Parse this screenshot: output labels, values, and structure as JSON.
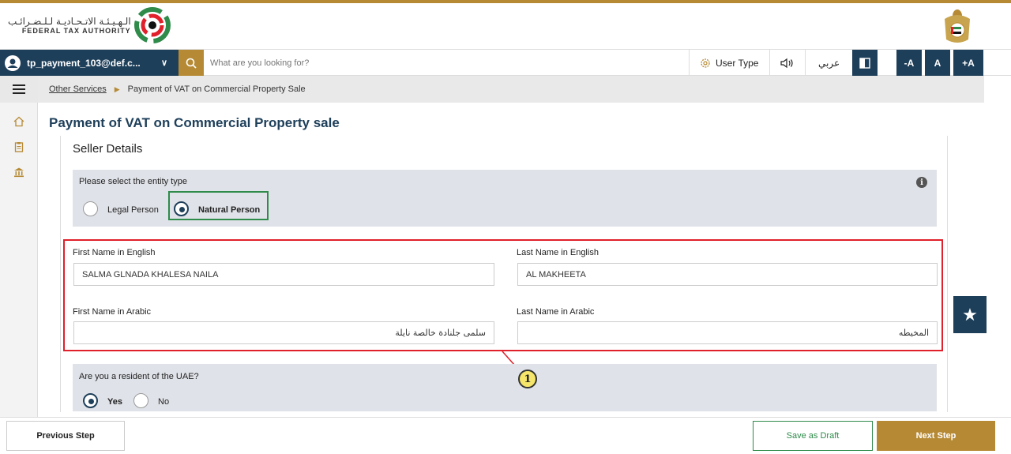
{
  "header": {
    "logo_ar": "الـهـيـئـة الاتـحـاديـة لـلـضـرائـب",
    "logo_en": "FEDERAL TAX AUTHORITY"
  },
  "navbar": {
    "user_email": "tp_payment_103@def.c...",
    "search_placeholder": "What are you looking for?",
    "user_type_label": "User Type",
    "language_label": "عربي",
    "font_decrease_label": "-A",
    "font_reset_label": "A",
    "font_increase_label": "+A"
  },
  "breadcrumb": {
    "parent": "Other Services",
    "current": "Payment of VAT on Commercial Property Sale"
  },
  "page": {
    "title": "Payment of VAT on Commercial Property sale",
    "section_title": "Seller Details"
  },
  "entity": {
    "question": "Please select the entity type",
    "options": [
      {
        "label": "Legal Person",
        "selected": false
      },
      {
        "label": "Natural Person",
        "selected": true
      }
    ]
  },
  "names": {
    "first_en_label": "First Name in English",
    "first_en_value": "SALMA GLNADA KHALESA NAILA",
    "last_en_label": "Last Name in English",
    "last_en_value": "AL MAKHEETA",
    "first_ar_label": "First Name in Arabic",
    "first_ar_value": "سلمى جلنادة خالصة نايلة",
    "last_ar_label": "Last Name in Arabic",
    "last_ar_value": "المخيطه"
  },
  "callout": {
    "number": "1"
  },
  "resident": {
    "question": "Are you a resident of the UAE?",
    "options": [
      {
        "label": "Yes",
        "selected": true
      },
      {
        "label": "No",
        "selected": false
      }
    ]
  },
  "footer": {
    "previous_label": "Previous Step",
    "draft_label": "Save as Draft",
    "next_label": "Next Step"
  },
  "colors": {
    "brand_gold": "#b68a35",
    "brand_navy": "#1e3f5a",
    "highlight_green": "#2e8b4a",
    "highlight_red": "#e0202a"
  }
}
